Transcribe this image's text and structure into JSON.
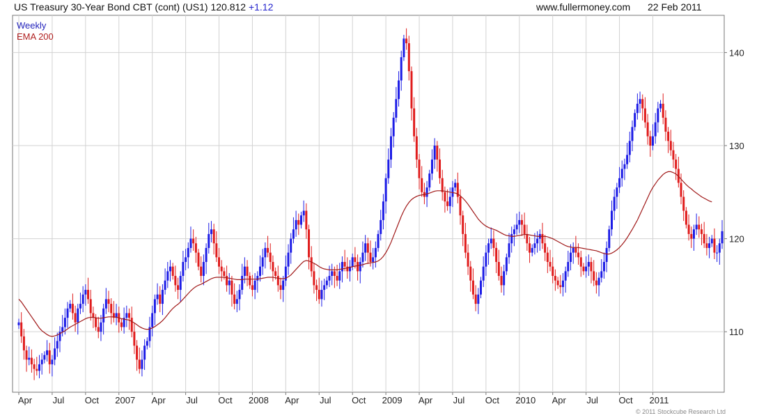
{
  "header": {
    "title": "US Treasury 30-Year  Bond CBT (cont) (US1)",
    "last": "120.812",
    "change": "+1.12",
    "site": "www.fullermoney.com",
    "date": "22 Feb 2011"
  },
  "legend": {
    "weekly": "Weekly",
    "ema": "EMA 200"
  },
  "copyright": "© 2011 Stockcube Research Ltd",
  "colors": {
    "up": "#1c1ce6",
    "down": "#e01c1c",
    "ema": "#a01818",
    "grid": "#d2d2d2"
  },
  "chart_data": {
    "type": "candlestick",
    "ylim": [
      103.5,
      144
    ],
    "yticks": [
      110,
      120,
      130,
      140
    ],
    "xticks": [
      {
        "label": "Apr",
        "index": 0
      },
      {
        "label": "Jul",
        "index": 13
      },
      {
        "label": "Oct",
        "index": 26
      },
      {
        "label": "2007",
        "index": 39
      },
      {
        "label": "Apr",
        "index": 52
      },
      {
        "label": "Jul",
        "index": 65
      },
      {
        "label": "Oct",
        "index": 78
      },
      {
        "label": "2008",
        "index": 91
      },
      {
        "label": "Apr",
        "index": 104
      },
      {
        "label": "Jul",
        "index": 117
      },
      {
        "label": "Oct",
        "index": 130
      },
      {
        "label": "2009",
        "index": 143
      },
      {
        "label": "Apr",
        "index": 156
      },
      {
        "label": "Jul",
        "index": 169
      },
      {
        "label": "Oct",
        "index": 182
      },
      {
        "label": "2010",
        "index": 195
      },
      {
        "label": "Apr",
        "index": 208
      },
      {
        "label": "Jul",
        "index": 221
      },
      {
        "label": "Oct",
        "index": 234
      },
      {
        "label": "2011",
        "index": 247
      }
    ],
    "series": [
      {
        "name": "Weekly",
        "close_values": [
          111.0,
          109.5,
          108.0,
          107.0,
          107.2,
          106.5,
          106.0,
          105.8,
          106.5,
          107.0,
          107.5,
          108.0,
          106.5,
          107.0,
          108.2,
          109.0,
          110.0,
          110.5,
          111.5,
          112.5,
          113.0,
          112.0,
          111.0,
          112.5,
          113.0,
          114.0,
          114.5,
          113.5,
          112.0,
          111.5,
          110.5,
          110.0,
          111.0,
          112.5,
          113.5,
          113.0,
          112.0,
          111.5,
          112.0,
          111.0,
          110.5,
          111.5,
          112.0,
          111.5,
          110.0,
          108.5,
          107.0,
          106.0,
          107.0,
          108.5,
          109.0,
          110.5,
          112.0,
          113.5,
          114.0,
          113.0,
          114.5,
          115.5,
          116.5,
          117.0,
          116.0,
          115.0,
          114.5,
          116.0,
          117.5,
          118.0,
          119.0,
          120.0,
          119.5,
          118.5,
          117.0,
          116.0,
          117.5,
          119.0,
          120.5,
          121.0,
          119.5,
          118.0,
          117.0,
          116.5,
          116.0,
          115.0,
          115.5,
          114.0,
          113.0,
          113.5,
          114.5,
          116.0,
          117.0,
          116.0,
          115.0,
          114.5,
          115.5,
          116.0,
          117.0,
          118.0,
          119.0,
          118.5,
          117.5,
          116.5,
          116.0,
          115.0,
          114.5,
          115.5,
          117.0,
          118.5,
          120.0,
          121.0,
          122.0,
          121.5,
          122.5,
          123.0,
          121.0,
          118.0,
          116.5,
          115.0,
          114.5,
          113.5,
          114.5,
          115.0,
          115.5,
          116.0,
          116.5,
          116.0,
          115.5,
          116.5,
          117.5,
          117.0,
          116.5,
          117.0,
          118.0,
          117.5,
          116.5,
          117.5,
          118.5,
          119.5,
          118.5,
          117.5,
          118.0,
          119.0,
          120.5,
          122.0,
          124.0,
          126.5,
          128.5,
          131.0,
          133.0,
          135.0,
          137.0,
          139.5,
          141.5,
          141.0,
          138.0,
          134.0,
          131.0,
          128.5,
          126.5,
          125.0,
          124.5,
          125.5,
          127.0,
          128.5,
          130.0,
          128.5,
          126.5,
          125.0,
          124.0,
          123.5,
          124.5,
          125.5,
          126.0,
          124.5,
          122.5,
          120.5,
          118.5,
          117.0,
          115.5,
          114.0,
          113.0,
          114.0,
          115.5,
          117.0,
          118.5,
          119.5,
          120.0,
          119.0,
          117.5,
          116.0,
          115.0,
          116.5,
          118.0,
          119.5,
          120.5,
          121.0,
          121.5,
          122.0,
          121.5,
          120.5,
          119.5,
          118.5,
          119.0,
          119.5,
          120.0,
          120.5,
          119.5,
          118.5,
          117.5,
          117.0,
          116.0,
          115.5,
          115.0,
          114.8,
          115.5,
          116.5,
          117.5,
          118.5,
          119.0,
          118.5,
          118.0,
          117.0,
          116.5,
          117.0,
          117.5,
          116.5,
          115.5,
          115.0,
          115.8,
          116.5,
          117.5,
          119.0,
          121.0,
          123.0,
          124.5,
          125.5,
          126.5,
          127.5,
          128.0,
          129.0,
          130.5,
          132.0,
          133.5,
          134.5,
          135.0,
          134.0,
          132.5,
          131.0,
          130.0,
          131.0,
          132.5,
          134.0,
          134.5,
          133.0,
          131.5,
          130.5,
          129.5,
          128.5,
          127.5,
          126.0,
          124.5,
          123.0,
          121.5,
          120.5,
          120.0,
          121.0,
          121.5,
          121.0,
          120.5,
          119.5,
          119.0,
          119.5,
          120.0,
          118.5,
          118.5,
          119.5,
          120.8
        ]
      },
      {
        "name": "EMA 200",
        "values": [
          113.5,
          113.2,
          112.8,
          112.4,
          112.0,
          111.6,
          111.2,
          110.8,
          110.4,
          110.1,
          109.9,
          109.7,
          109.55,
          109.5,
          109.55,
          109.65,
          109.8,
          109.95,
          110.1,
          110.3,
          110.5,
          110.65,
          110.8,
          110.95,
          111.1,
          111.25,
          111.4,
          111.5,
          111.55,
          111.55,
          111.5,
          111.45,
          111.45,
          111.5,
          111.55,
          111.6,
          111.6,
          111.6,
          111.55,
          111.5,
          111.4,
          111.35,
          111.3,
          111.25,
          111.1,
          110.95,
          110.75,
          110.55,
          110.4,
          110.3,
          110.25,
          110.3,
          110.4,
          110.55,
          110.75,
          110.95,
          111.2,
          111.5,
          111.85,
          112.2,
          112.5,
          112.75,
          112.95,
          113.2,
          113.5,
          113.8,
          114.1,
          114.4,
          114.65,
          114.85,
          115.0,
          115.1,
          115.25,
          115.4,
          115.55,
          115.7,
          115.8,
          115.85,
          115.85,
          115.85,
          115.85,
          115.8,
          115.75,
          115.7,
          115.65,
          115.6,
          115.6,
          115.6,
          115.65,
          115.65,
          115.65,
          115.65,
          115.65,
          115.65,
          115.7,
          115.75,
          115.8,
          115.85,
          115.85,
          115.85,
          115.8,
          115.75,
          115.7,
          115.7,
          115.75,
          115.9,
          116.1,
          116.4,
          116.7,
          117.0,
          117.3,
          117.55,
          117.65,
          117.6,
          117.5,
          117.35,
          117.2,
          117.0,
          116.85,
          116.75,
          116.7,
          116.65,
          116.65,
          116.65,
          116.65,
          116.7,
          116.75,
          116.8,
          116.85,
          116.9,
          117.0,
          117.05,
          117.1,
          117.15,
          117.2,
          117.3,
          117.35,
          117.4,
          117.45,
          117.5,
          117.6,
          117.8,
          118.1,
          118.5,
          119.0,
          119.6,
          120.3,
          121.0,
          121.7,
          122.4,
          123.0,
          123.5,
          123.9,
          124.2,
          124.4,
          124.55,
          124.65,
          124.7,
          124.75,
          124.8,
          124.9,
          125.0,
          125.1,
          125.15,
          125.15,
          125.15,
          125.1,
          125.05,
          125.0,
          124.95,
          124.9,
          124.8,
          124.6,
          124.35,
          124.05,
          123.7,
          123.3,
          122.9,
          122.5,
          122.1,
          121.8,
          121.55,
          121.35,
          121.2,
          121.1,
          121.0,
          120.9,
          120.75,
          120.6,
          120.45,
          120.35,
          120.3,
          120.25,
          120.25,
          120.3,
          120.35,
          120.4,
          120.45,
          120.45,
          120.4,
          120.35,
          120.3,
          120.25,
          120.25,
          120.25,
          120.25,
          120.2,
          120.1,
          120.0,
          119.85,
          119.7,
          119.55,
          119.4,
          119.25,
          119.15,
          119.1,
          119.05,
          119.05,
          119.05,
          119.0,
          118.95,
          118.9,
          118.85,
          118.8,
          118.75,
          118.7,
          118.6,
          118.5,
          118.4,
          118.35,
          118.35,
          118.45,
          118.6,
          118.8,
          119.05,
          119.35,
          119.7,
          120.1,
          120.55,
          121.0,
          121.5,
          122.0,
          122.6,
          123.2,
          123.8,
          124.4,
          125.0,
          125.5,
          125.9,
          126.3,
          126.6,
          126.9,
          127.1,
          127.2,
          127.2,
          127.1,
          126.95,
          126.7,
          126.4,
          126.1,
          125.8,
          125.55,
          125.35,
          125.1,
          124.9,
          124.7,
          124.5,
          124.35,
          124.2,
          124.05,
          123.95
        ]
      }
    ]
  }
}
